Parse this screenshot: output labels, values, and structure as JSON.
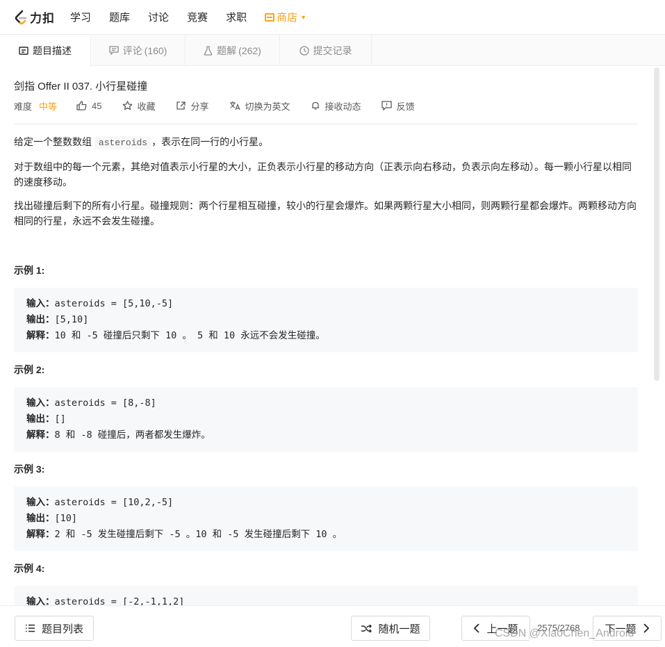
{
  "nav": {
    "logo_text": "力扣",
    "items": [
      "学习",
      "题库",
      "讨论",
      "竞赛",
      "求职"
    ],
    "shop_label": "商店",
    "accent": "#ffa116"
  },
  "tabs": [
    {
      "label": "题目描述",
      "icon": "description-icon",
      "count": ""
    },
    {
      "label": "评论",
      "icon": "comment-icon",
      "count": "(160)"
    },
    {
      "label": "题解",
      "icon": "flask-icon",
      "count": "(262)"
    },
    {
      "label": "提交记录",
      "icon": "history-icon",
      "count": ""
    }
  ],
  "problem": {
    "title": "剑指 Offer II 037. 小行星碰撞",
    "difficulty_label": "难度",
    "difficulty": "中等",
    "likes": "45",
    "favorite": "收藏",
    "share": "分享",
    "switch_lang": "切换为英文",
    "follow": "接收动态",
    "feedback": "反馈"
  },
  "description": {
    "p1_before": "给定一个整数数组 ",
    "p1_code": "asteroids",
    "p1_after": "，表示在同一行的小行星。",
    "p2": "对于数组中的每一个元素，其绝对值表示小行星的大小，正负表示小行星的移动方向（正表示向右移动，负表示向左移动）。每一颗小行星以相同的速度移动。",
    "p3": "找出碰撞后剩下的所有小行星。碰撞规则：两个行星相互碰撞，较小的行星会爆炸。如果两颗行星大小相同，则两颗行星都会爆炸。两颗移动方向相同的行星，永远不会发生碰撞。"
  },
  "examples": [
    {
      "title": "示例 1:",
      "input_label": "输入：",
      "input": "asteroids = [5,10,-5]",
      "output_label": "输出：",
      "output": "[5,10]",
      "explain_label": "解释：",
      "explain": "10 和 -5 碰撞后只剩下 10 。 5 和 10 永远不会发生碰撞。"
    },
    {
      "title": "示例 2:",
      "input_label": "输入：",
      "input": "asteroids = [8,-8]",
      "output_label": "输出：",
      "output": "[]",
      "explain_label": "解释：",
      "explain": "8 和 -8 碰撞后，两者都发生爆炸。"
    },
    {
      "title": "示例 3:",
      "input_label": "输入：",
      "input": "asteroids = [10,2,-5]",
      "output_label": "输出：",
      "output": "[10]",
      "explain_label": "解释：",
      "explain": "2 和 -5 发生碰撞后剩下 -5 。10 和 -5 发生碰撞后剩下 10 。"
    },
    {
      "title": "示例 4:",
      "input_label": "输入：",
      "input": "asteroids = [-2,-1,1,2]"
    }
  ],
  "footer": {
    "list_button": "题目列表",
    "random_button": "随机一题",
    "prev_button": "上一题",
    "page": "2575/2768",
    "next_button": "下一题",
    "watermark": "CSDN @XiaoChen_Android"
  }
}
